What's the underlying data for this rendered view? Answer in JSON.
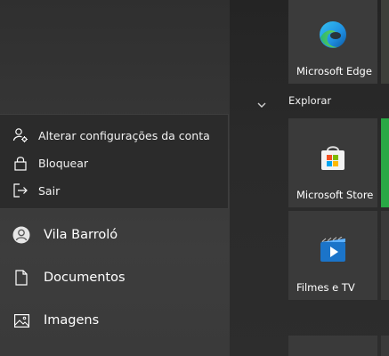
{
  "account_menu": {
    "items": [
      {
        "label": "Alterar configurações da conta",
        "icon": "user-settings-icon"
      },
      {
        "label": "Bloquear",
        "icon": "lock-icon"
      },
      {
        "label": "Sair",
        "icon": "sign-out-icon"
      }
    ]
  },
  "left_list": {
    "items": [
      {
        "label": "Vila Barroló",
        "icon": "user-avatar-icon"
      },
      {
        "label": "Documentos",
        "icon": "document-icon"
      },
      {
        "label": "Imagens",
        "icon": "pictures-icon"
      }
    ]
  },
  "tiles": {
    "edge": {
      "label": "Microsoft Edge",
      "icon": "edge-icon"
    },
    "group_title": "Explorar",
    "store": {
      "label": "Microsoft Store",
      "icon": "store-icon"
    },
    "movies": {
      "label": "Filmes e TV",
      "icon": "movies-tv-icon"
    }
  },
  "colors": {
    "accent_green": "#29a845",
    "tile_bg": "#3a3a3a",
    "edge_blue": "#1e8ee0",
    "edge_green": "#4bc84b",
    "store_red": "#f25022",
    "store_green": "#7fba00",
    "store_blue": "#00a4ef",
    "store_yellow": "#ffb900",
    "movies_blue": "#1b74c9"
  }
}
